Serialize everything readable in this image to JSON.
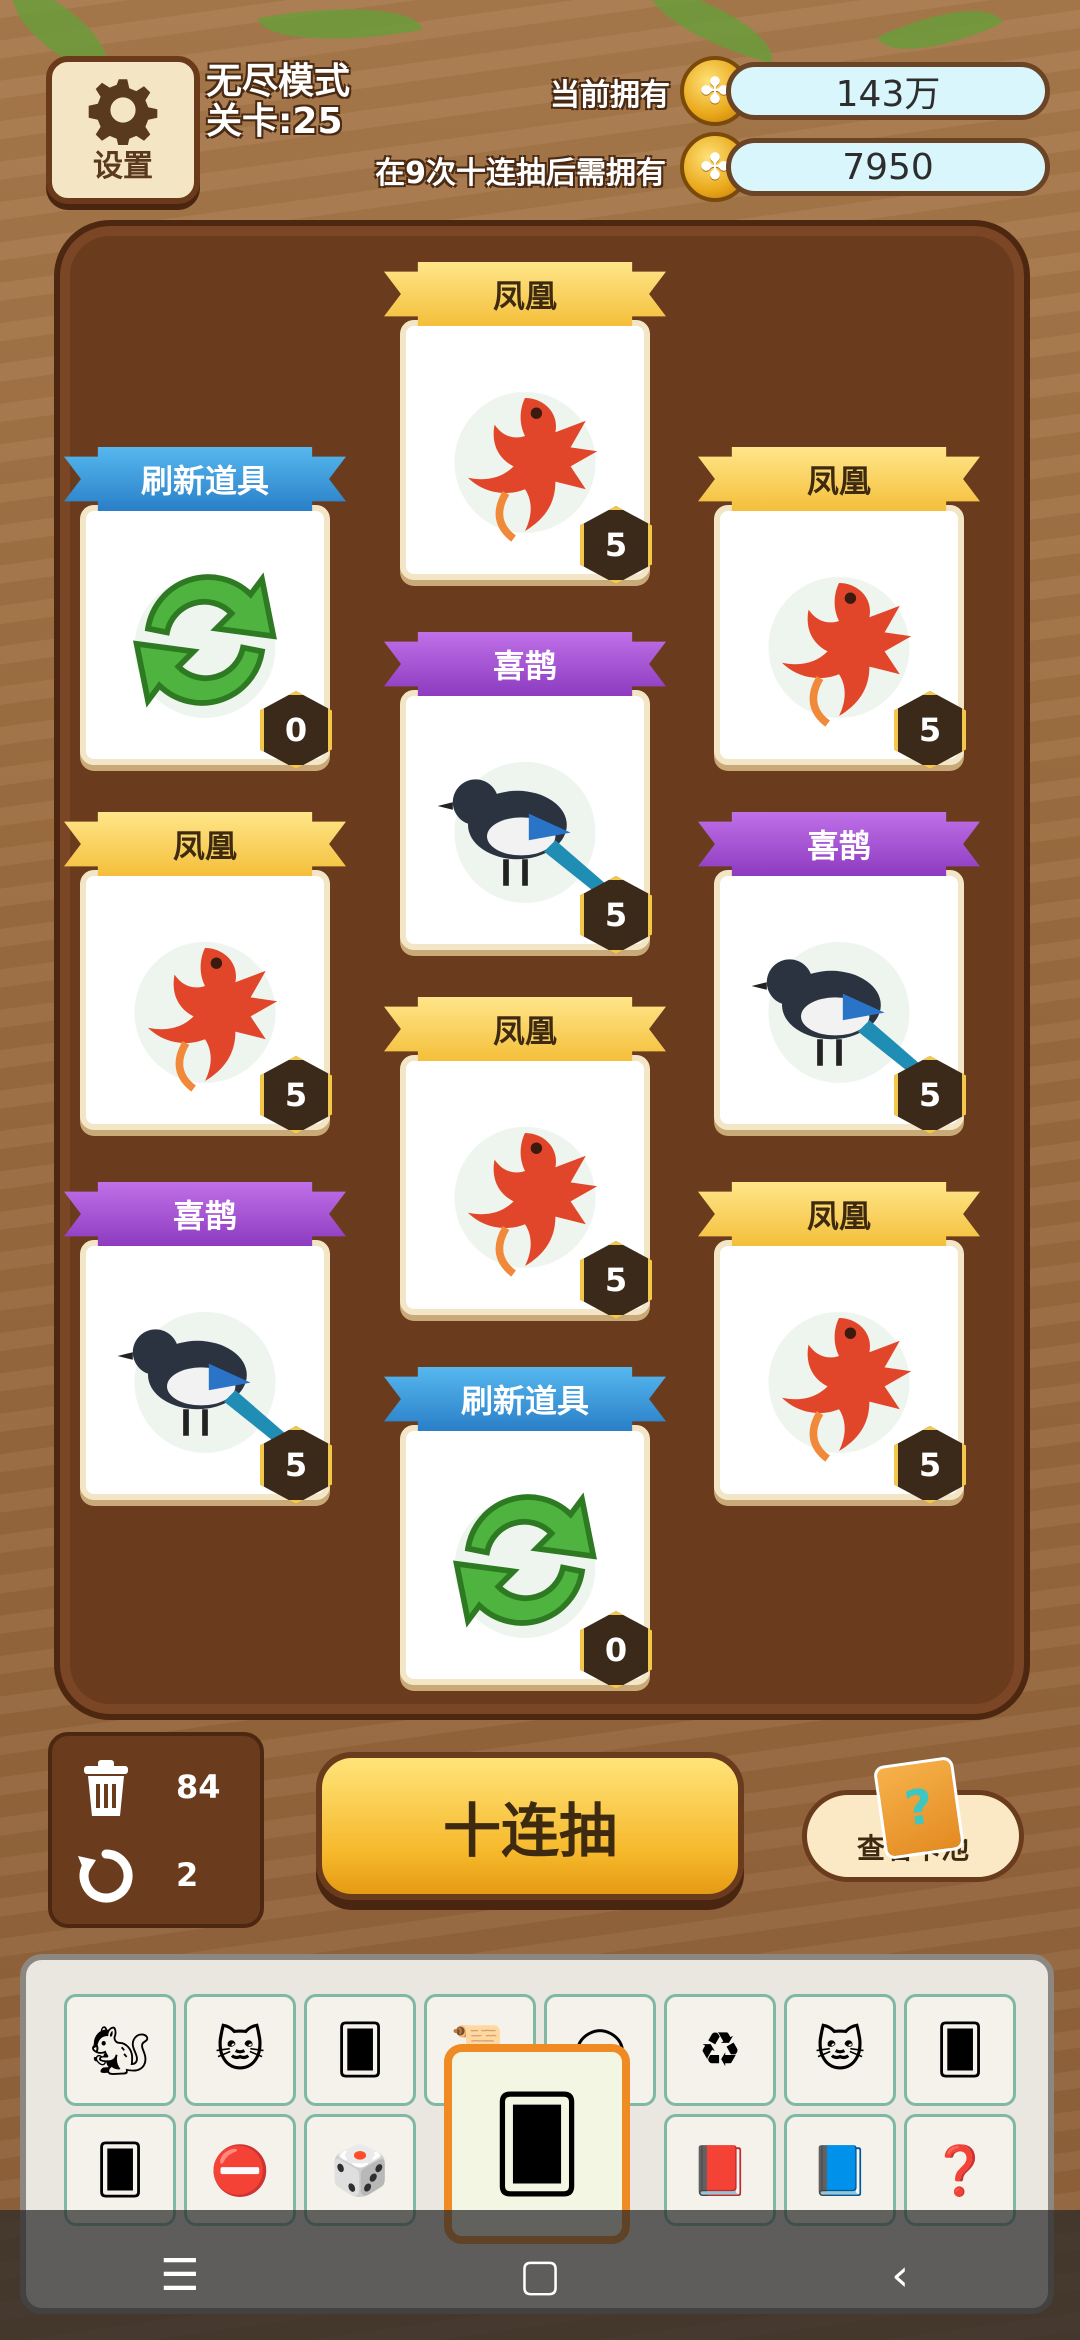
{
  "header": {
    "settings_label": "设置",
    "mode": "无尽模式",
    "level": "关卡:25",
    "current_label": "当前拥有",
    "current_value": "143万",
    "need_label": "在9次十连抽后需拥有",
    "need_value": "7950"
  },
  "cards": [
    {
      "title": "凤凰",
      "ribbon": "gold",
      "art": "phoenix",
      "count": "5"
    },
    {
      "title": "刷新道具",
      "ribbon": "blue",
      "art": "refresh",
      "count": "0"
    },
    {
      "title": "凤凰",
      "ribbon": "gold",
      "art": "phoenix",
      "count": "5"
    },
    {
      "title": "喜鹊",
      "ribbon": "purple",
      "art": "magpie",
      "count": "5"
    },
    {
      "title": "凤凰",
      "ribbon": "gold",
      "art": "phoenix",
      "count": "5"
    },
    {
      "title": "喜鹊",
      "ribbon": "purple",
      "art": "magpie",
      "count": "5"
    },
    {
      "title": "凤凰",
      "ribbon": "gold",
      "art": "phoenix",
      "count": "5"
    },
    {
      "title": "喜鹊",
      "ribbon": "purple",
      "art": "magpie",
      "count": "5"
    },
    {
      "title": "凤凰",
      "ribbon": "gold",
      "art": "phoenix",
      "count": "5"
    },
    {
      "title": "刷新道具",
      "ribbon": "blue",
      "art": "refresh",
      "count": "0"
    }
  ],
  "controls": {
    "trash_count": "84",
    "undo_count": "2",
    "draw_label": "十连抽",
    "pool_label": "查看卡池"
  },
  "inventory": {
    "row1": [
      "squirrel-icon",
      "lucky-cat-icon",
      "card-pack-icon",
      "scroll-icon",
      "grey-slot-icon",
      "recycle-icon",
      "lucky-cat-icon",
      "card-pack-icon"
    ],
    "row2": [
      "card-pack-x2-icon",
      "no-icon",
      "dice-plus-icon",
      "",
      "",
      "pink-book-icon",
      "blue-book-icon",
      "mystery-card-icon"
    ],
    "selected": "card-pack-coins-icon"
  },
  "nav": {
    "menu": "☰",
    "home": "▢",
    "back": "‹"
  }
}
